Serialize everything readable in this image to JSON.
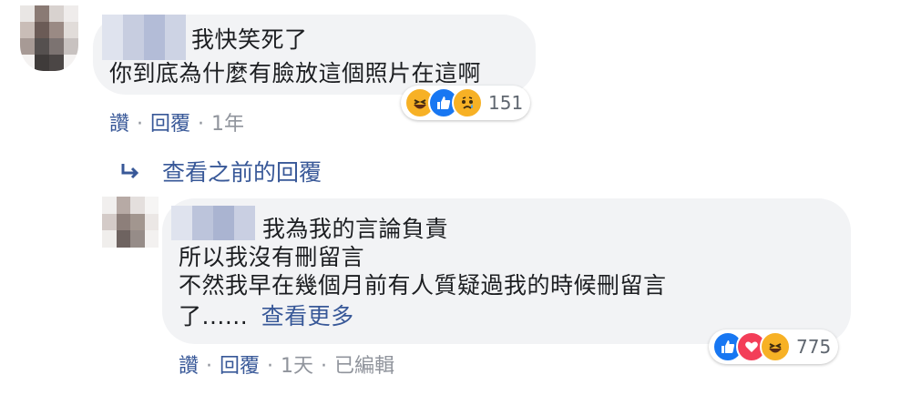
{
  "comment1": {
    "lines": [
      "我快笑死了",
      "你到底為什麼有臉放這個照片在這啊"
    ],
    "reaction_count": "151",
    "reaction_icons": [
      "haha-icon",
      "like-icon",
      "sad-icon"
    ],
    "actions": {
      "like": "讚",
      "reply": "回覆",
      "time": "1年"
    }
  },
  "view_previous": {
    "label": "查看之前的回覆"
  },
  "reply1": {
    "lines": [
      "我為我的言論負責",
      "所以我沒有刪留言",
      "不然我早在幾個月前有人質疑過我的時候刪留言",
      "了......"
    ],
    "see_more": "查看更多",
    "reaction_count": "775",
    "reaction_icons": [
      "like-icon",
      "love-icon",
      "haha-icon"
    ],
    "actions": {
      "like": "讚",
      "reply": "回覆",
      "time": "1天",
      "edited": "已編輯"
    }
  },
  "colors": {
    "link": "#385898",
    "bubble": "#f2f3f5",
    "like": "#1877f2",
    "love": "#f33e58",
    "haha": "#f7b125"
  }
}
